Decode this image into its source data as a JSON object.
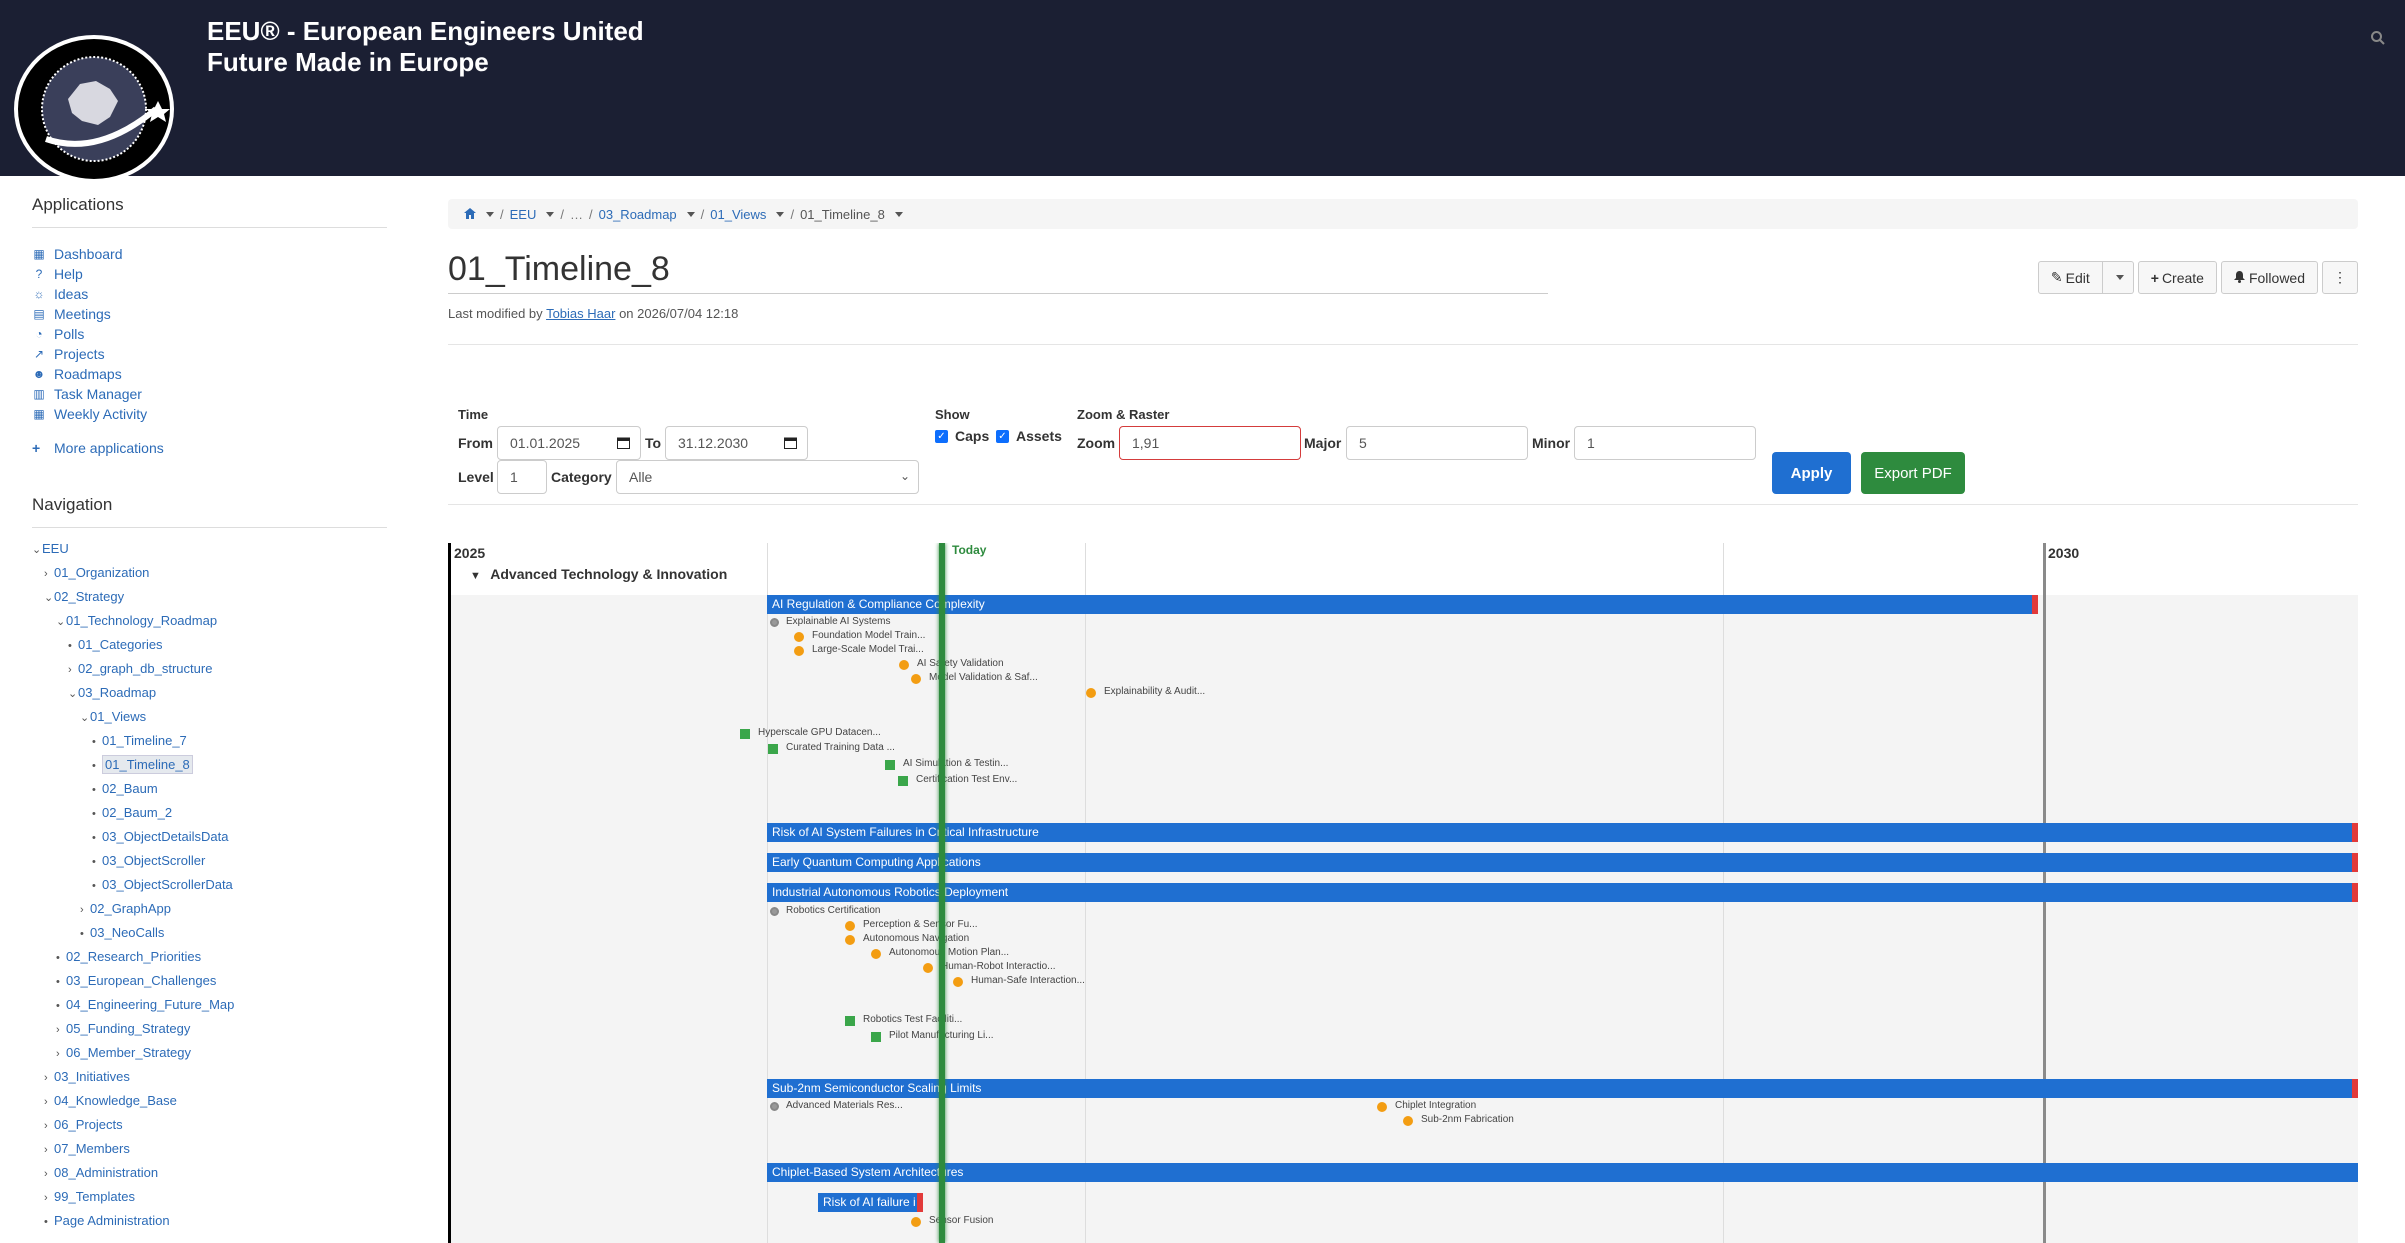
{
  "header": {
    "title_line1": "EEU® - European Engineers United",
    "title_line2": "Future Made in Europe"
  },
  "sidebar": {
    "apps_heading": "Applications",
    "apps": [
      {
        "label": "Dashboard",
        "icon": "dashboard-icon"
      },
      {
        "label": "Help",
        "icon": "help-icon"
      },
      {
        "label": "Ideas",
        "icon": "lightbulb-icon"
      },
      {
        "label": "Meetings",
        "icon": "calendar-icon"
      },
      {
        "label": "Polls",
        "icon": "pie-chart-icon"
      },
      {
        "label": "Projects",
        "icon": "line-chart-icon"
      },
      {
        "label": "Roadmaps",
        "icon": "users-icon"
      },
      {
        "label": "Task Manager",
        "icon": "table-icon"
      },
      {
        "label": "Weekly Activity",
        "icon": "calendar-grid-icon"
      }
    ],
    "more_apps": "More applications",
    "nav_heading": "Navigation",
    "tree": [
      {
        "label": "EEU",
        "indent": 0,
        "type": "open"
      },
      {
        "label": "01_Organization",
        "indent": 1,
        "type": "closed"
      },
      {
        "label": "02_Strategy",
        "indent": 1,
        "type": "open"
      },
      {
        "label": "01_Technology_Roadmap",
        "indent": 2,
        "type": "open"
      },
      {
        "label": "01_Categories",
        "indent": 3,
        "type": "leaf"
      },
      {
        "label": "02_graph_db_structure",
        "indent": 3,
        "type": "closed"
      },
      {
        "label": "03_Roadmap",
        "indent": 3,
        "type": "open"
      },
      {
        "label": "01_Views",
        "indent": 4,
        "type": "open"
      },
      {
        "label": "01_Timeline_7",
        "indent": 5,
        "type": "leaf"
      },
      {
        "label": "01_Timeline_8",
        "indent": 5,
        "type": "leaf",
        "selected": true
      },
      {
        "label": "02_Baum",
        "indent": 5,
        "type": "leaf"
      },
      {
        "label": "02_Baum_2",
        "indent": 5,
        "type": "leaf"
      },
      {
        "label": "03_ObjectDetailsData",
        "indent": 5,
        "type": "leaf"
      },
      {
        "label": "03_ObjectScroller",
        "indent": 5,
        "type": "leaf"
      },
      {
        "label": "03_ObjectScrollerData",
        "indent": 5,
        "type": "leaf"
      },
      {
        "label": "02_GraphApp",
        "indent": 4,
        "type": "closed"
      },
      {
        "label": "03_NeoCalls",
        "indent": 4,
        "type": "leaf"
      },
      {
        "label": "02_Research_Priorities",
        "indent": 2,
        "type": "leaf"
      },
      {
        "label": "03_European_Challenges",
        "indent": 2,
        "type": "leaf"
      },
      {
        "label": "04_Engineering_Future_Map",
        "indent": 2,
        "type": "leaf"
      },
      {
        "label": "05_Funding_Strategy",
        "indent": 2,
        "type": "closed"
      },
      {
        "label": "06_Member_Strategy",
        "indent": 2,
        "type": "closed"
      },
      {
        "label": "03_Initiatives",
        "indent": 1,
        "type": "closed"
      },
      {
        "label": "04_Knowledge_Base",
        "indent": 1,
        "type": "closed"
      },
      {
        "label": "06_Projects",
        "indent": 1,
        "type": "closed"
      },
      {
        "label": "07_Members",
        "indent": 1,
        "type": "closed"
      },
      {
        "label": "08_Administration",
        "indent": 1,
        "type": "closed"
      },
      {
        "label": "99_Templates",
        "indent": 1,
        "type": "closed"
      },
      {
        "label": "Page Administration",
        "indent": 1,
        "type": "leaf"
      }
    ]
  },
  "breadcrumb": {
    "items": [
      "EEU",
      "…",
      "03_Roadmap",
      "01_Views",
      "01_Timeline_8"
    ]
  },
  "page": {
    "title": "01_Timeline_8",
    "modified_prefix": "Last modified by",
    "modified_user": "Tobias Haar",
    "modified_suffix": "on 2026/07/04 12:18"
  },
  "actions": {
    "edit": "Edit",
    "create": "Create",
    "followed": "Followed"
  },
  "controls": {
    "time_heading": "Time",
    "from_label": "From",
    "from_value": "01.01.2025",
    "to_label": "To",
    "to_value": "31.12.2030",
    "level_label": "Level",
    "level_value": "1",
    "category_label": "Category",
    "category_value": "Alle",
    "show_heading": "Show",
    "caps_label": "Caps",
    "assets_label": "Assets",
    "caps_checked": true,
    "assets_checked": true,
    "zoom_heading": "Zoom & Raster",
    "zoom_label": "Zoom",
    "zoom_value": "1,91",
    "major_label": "Major",
    "major_value": "5",
    "minor_label": "Minor",
    "minor_value": "1",
    "apply": "Apply",
    "export": "Export PDF"
  },
  "timeline": {
    "year_start": "2025",
    "year_end": "2030",
    "today_label": "Today",
    "category": "Advanced Technology & Innovation",
    "bars": [
      "AI Regulation & Compliance Complexity",
      "Risk of AI System Failures in Critical Infrastructure",
      "Early Quantum Computing Applications",
      "Industrial Autonomous Robotics Deployment",
      "Sub-2nm Semiconductor Scaling Limits",
      "Chiplet-Based System Architectures",
      "Risk of AI failure i"
    ],
    "milestones": [
      "Explainable AI Systems",
      "Foundation Model Train...",
      "Large-Scale Model Trai...",
      "AI Safety Validation",
      "Model Validation & Saf...",
      "Explainability & Audit...",
      "Hyperscale GPU Datacen...",
      "Curated Training Data ...",
      "AI Simulation & Testin...",
      "Certification Test Env...",
      "Robotics Certification",
      "Perception & Sensor Fu...",
      "Autonomous Navigation",
      "Autonomous Motion Plan...",
      "Human-Robot Interactio...",
      "Human-Safe Interaction...",
      "Robotics Test Faciliti...",
      "Pilot Manufacturing Li...",
      "Advanced Materials Res...",
      "Chiplet Integration",
      "Sub-2nm Fabrication",
      "Sensor Fusion"
    ]
  },
  "colors": {
    "header_bg": "#1b1f33",
    "bar_blue": "#1f6fd1",
    "today_green": "#2e8b3e",
    "milestone_orange": "#f39d12",
    "asset_green": "#3aa64a",
    "risk_red": "#e23a3a"
  }
}
